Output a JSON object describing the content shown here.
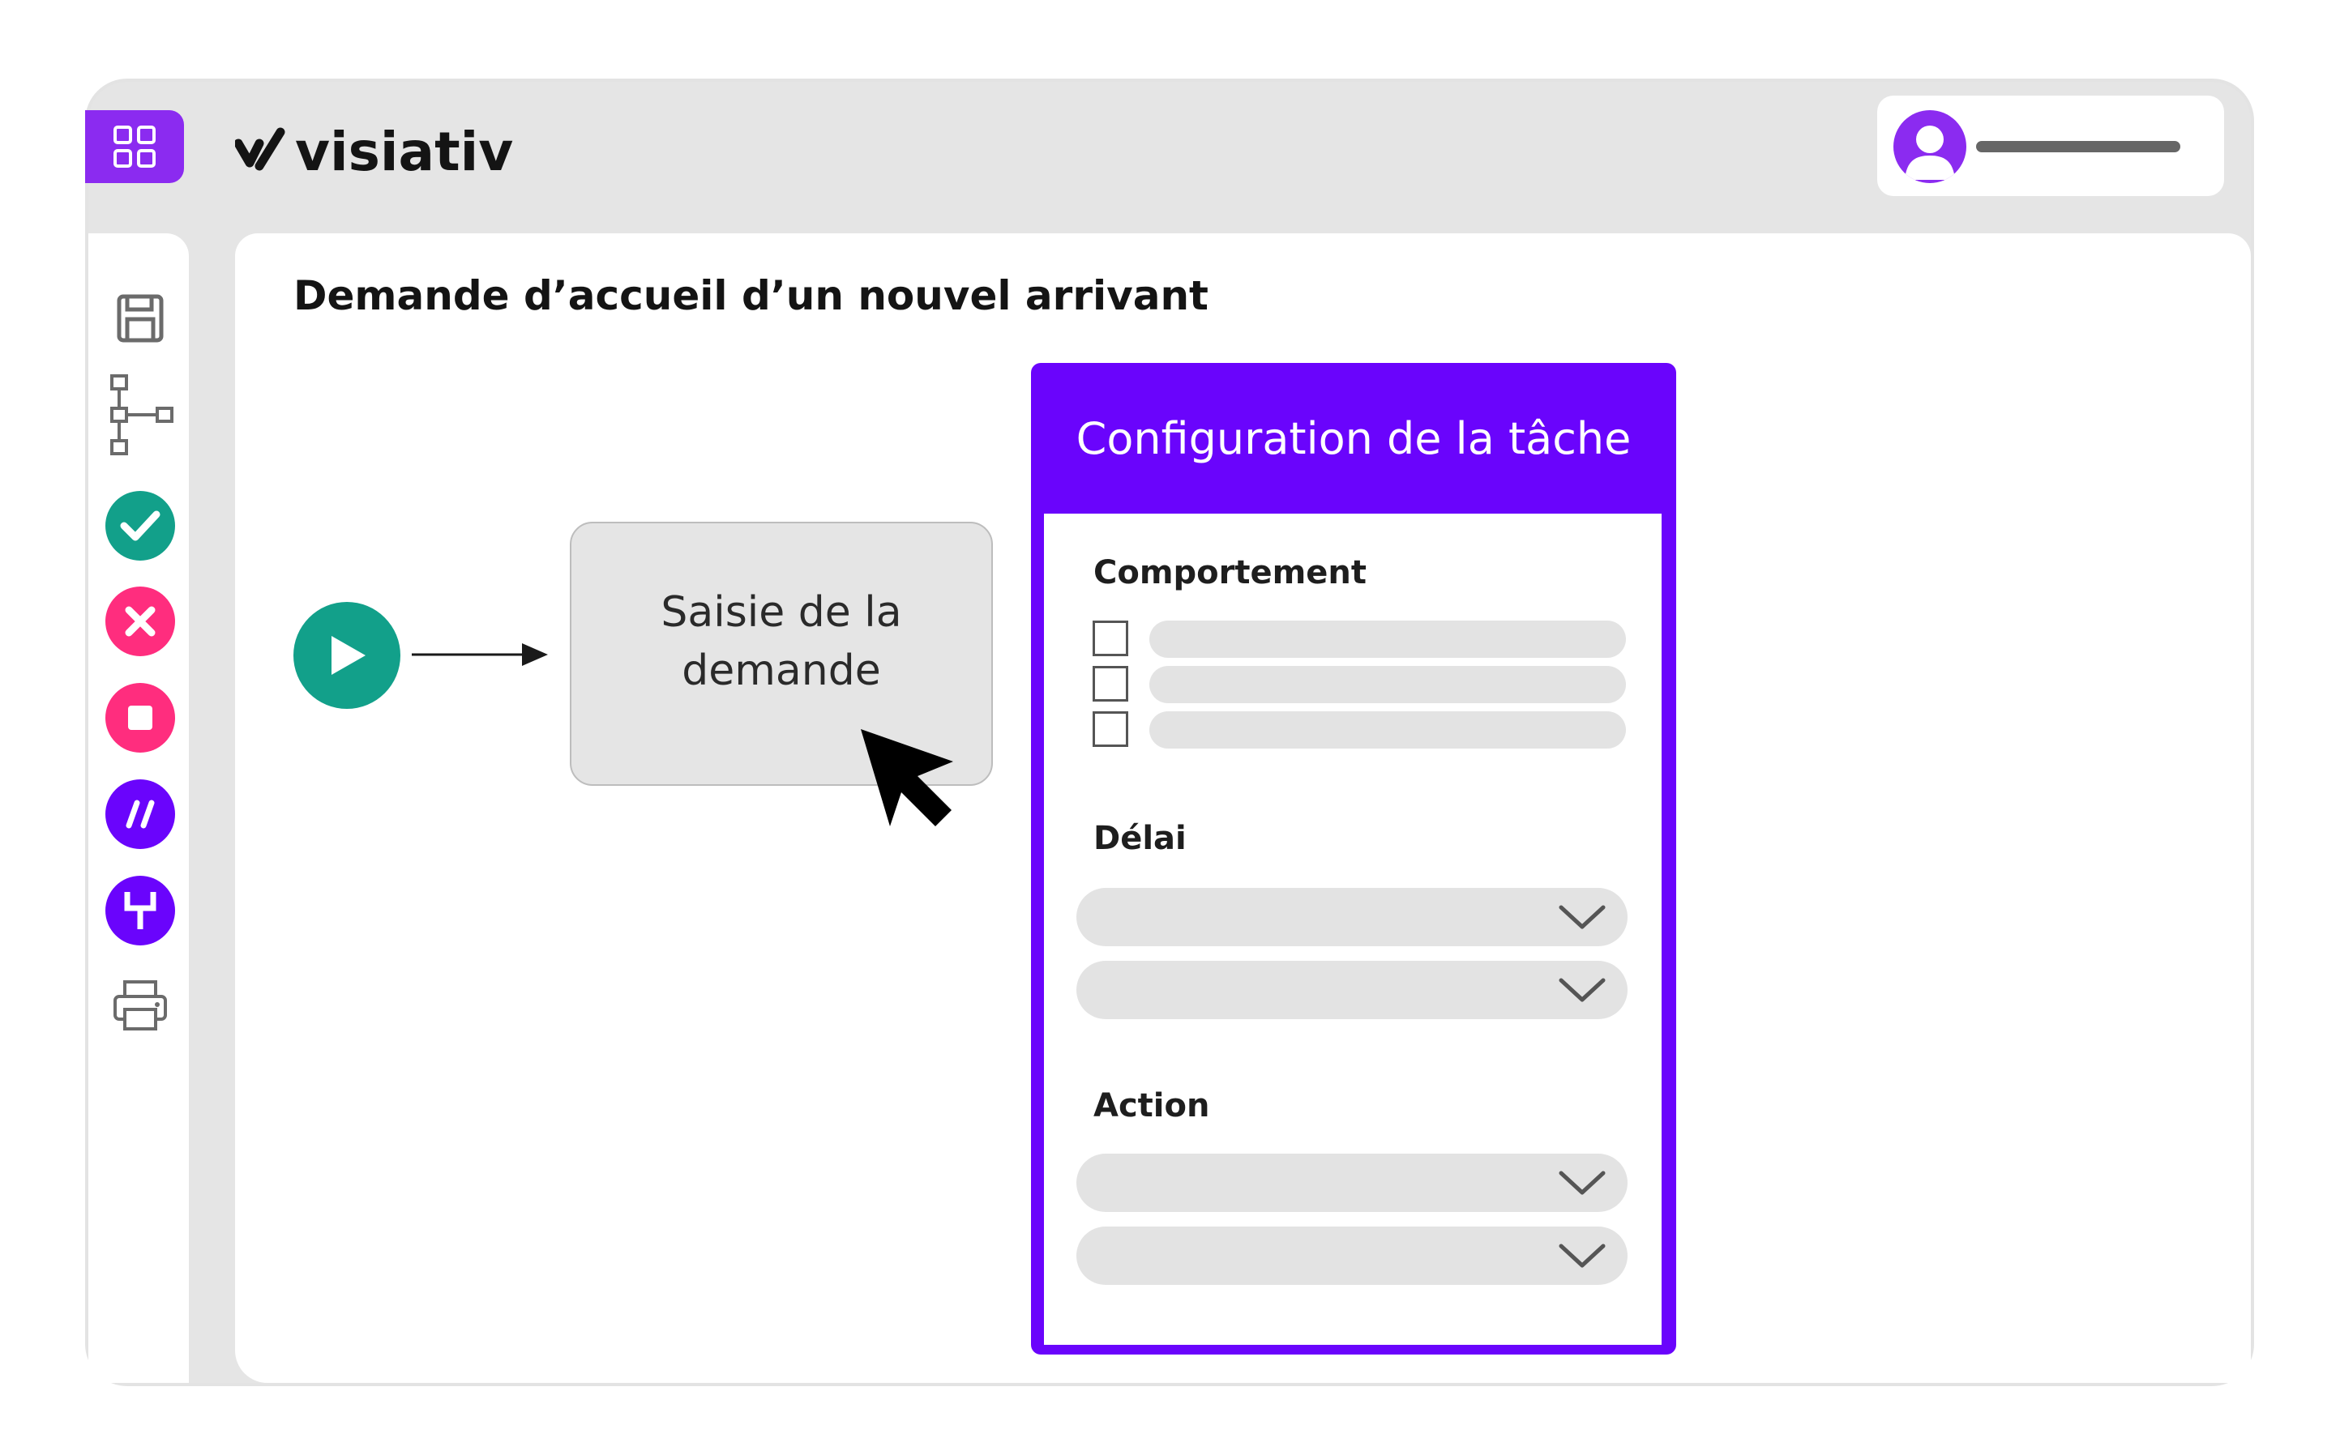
{
  "header": {
    "brand_name": "visiativ",
    "apps_icon": "grid-icon",
    "user_avatar_icon": "user-avatar-icon"
  },
  "sidebar": {
    "items": [
      {
        "name": "save",
        "icon": "floppy-disk-icon"
      },
      {
        "name": "workflow",
        "icon": "workflow-tree-icon"
      },
      {
        "name": "validate",
        "icon": "check-circle-icon",
        "color": "#12a08a"
      },
      {
        "name": "reject",
        "icon": "x-circle-icon",
        "color": "#ff2d7e"
      },
      {
        "name": "stop",
        "icon": "stop-circle-icon",
        "color": "#ff2d7e"
      },
      {
        "name": "parallel",
        "icon": "slashes-circle-icon",
        "color": "#6a04fc"
      },
      {
        "name": "merge",
        "icon": "merge-circle-icon",
        "color": "#6a04fc"
      },
      {
        "name": "print",
        "icon": "printer-icon"
      }
    ]
  },
  "main": {
    "title": "Demande d’accueil d’un nouvel arrivant",
    "workflow": {
      "start_icon": "play-icon",
      "task_label": "Saisie de la demande"
    }
  },
  "config": {
    "title": "Configuration de la tâche",
    "sections": {
      "behavior_label": "Comportement",
      "delay_label": "Délai",
      "action_label": "Action"
    }
  },
  "colors": {
    "accent_purple": "#6a04fc",
    "apps_purple": "#8b2bf0",
    "start_green": "#12a08a",
    "reject_pink": "#ff2d7e"
  }
}
